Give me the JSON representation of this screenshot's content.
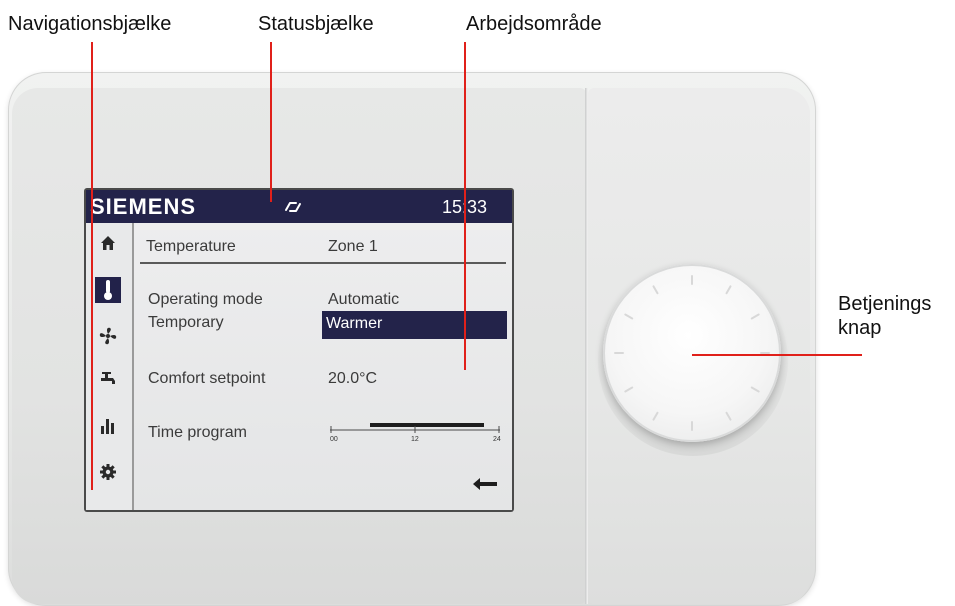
{
  "callouts": {
    "navigation": "Navigationsbjælke",
    "status": "Statusbjælke",
    "workspace": "Arbejdsområde",
    "knob_line1": "Betjenings",
    "knob_line2": "knap"
  },
  "statusbar": {
    "brand": "SIEMENS",
    "time": "15:33"
  },
  "workspace": {
    "header": {
      "label": "Temperature",
      "value": "Zone 1"
    },
    "rows": [
      {
        "label": "Operating mode",
        "value": "Automatic"
      },
      {
        "label": "Temporary",
        "value": "Warmer"
      },
      {
        "label": "Comfort setpoint",
        "value": "20.0°C"
      },
      {
        "label": "Time program",
        "ticks": [
          "00",
          "12",
          "24"
        ]
      }
    ]
  },
  "navigation": {
    "items": [
      {
        "icon": "home-icon",
        "active": false
      },
      {
        "icon": "thermometer-icon",
        "active": true
      },
      {
        "icon": "fan-icon",
        "active": false
      },
      {
        "icon": "water-tap-icon",
        "active": false
      },
      {
        "icon": "bar-chart-icon",
        "active": false
      },
      {
        "icon": "gear-icon",
        "active": false
      }
    ]
  },
  "colors": {
    "statusbar": "#23234a",
    "leader": "#e0201a"
  }
}
